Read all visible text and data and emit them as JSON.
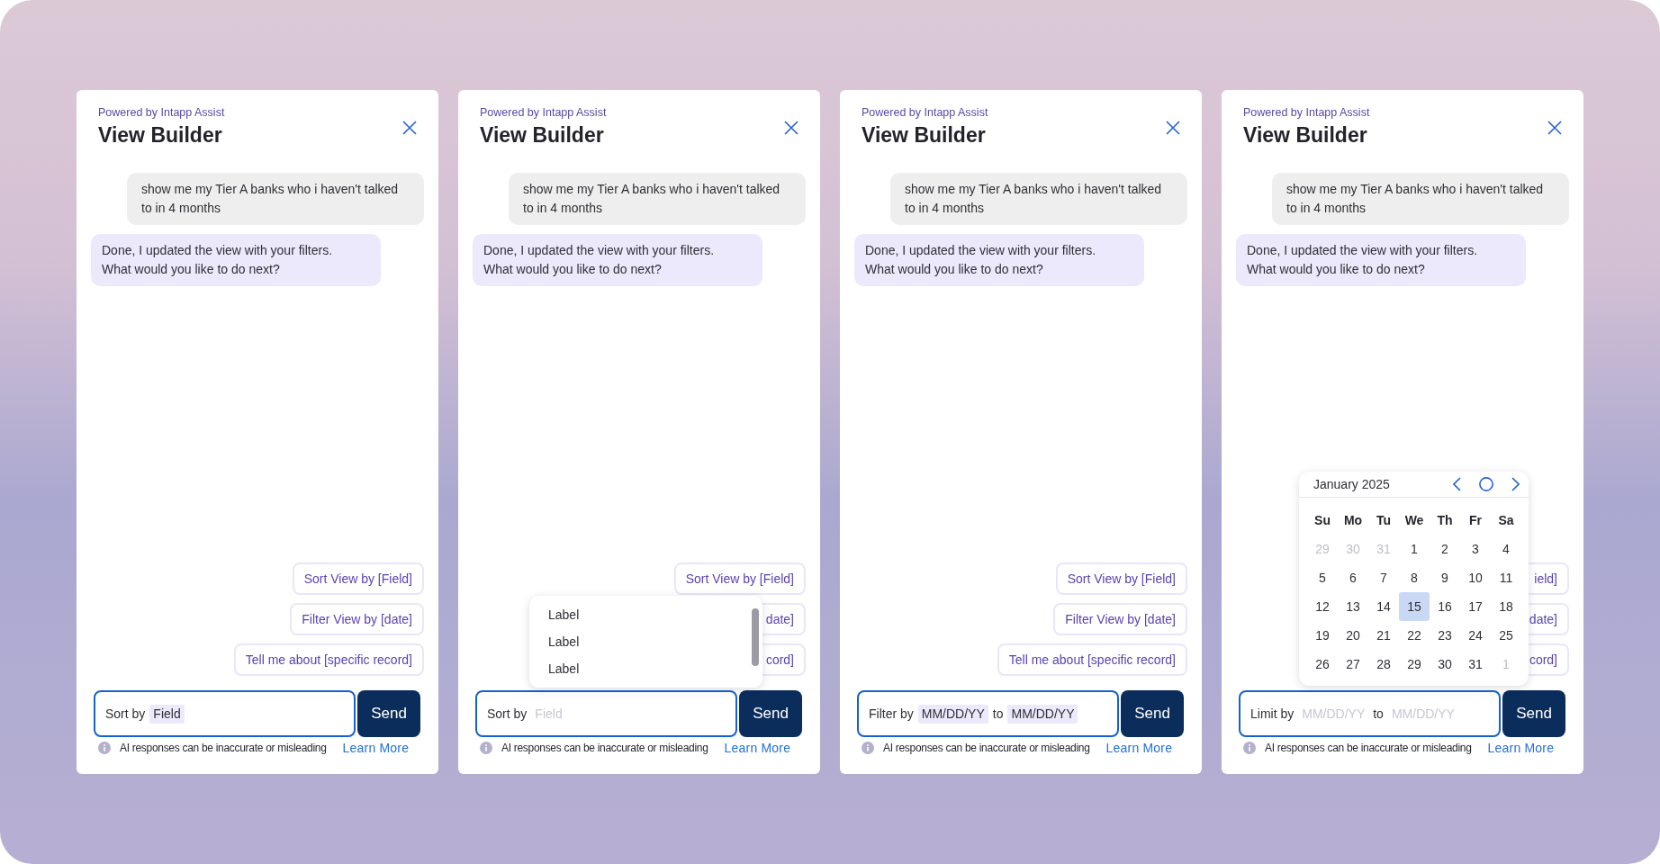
{
  "panels": [
    {
      "powered_by": "Powered by Intapp Assist",
      "title": "View Builder",
      "messages": [
        {
          "kind": "user",
          "text": "show me my Tier A banks who i haven't talked to in 4 months"
        },
        {
          "kind": "assistant",
          "text": "Done, I updated the view with your filters. What would you like to do next?"
        }
      ],
      "suggestions": [
        "Sort View by [Field]",
        "Filter View by [date]",
        "Tell me about [specific record]"
      ],
      "composer": {
        "focused": true,
        "parts": [
          {
            "kind": "text",
            "text": "Sort by"
          },
          {
            "kind": "slot",
            "value": "Field"
          }
        ]
      },
      "send_button": "Send",
      "disclaimer": "AI responses can be inaccurate or misleading",
      "learn_more": "Learn More"
    },
    {
      "powered_by": "Powered by Intapp Assist",
      "title": "View Builder",
      "messages": [
        {
          "kind": "user",
          "text": "show me my Tier A banks who i haven't talked to in 4 months"
        },
        {
          "kind": "assistant",
          "text": "Done, I updated the view with your filters. What would you like to do next?"
        }
      ],
      "suggestions": [
        "Sort View by [Field]",
        "date]",
        "cord]"
      ],
      "dropdown": {
        "options": [
          {
            "label": "Label",
            "selected": false
          },
          {
            "label": "Label",
            "selected": false
          },
          {
            "label": "Label",
            "selected": false
          }
        ]
      },
      "composer": {
        "focused": true,
        "parts": [
          {
            "kind": "text",
            "text": "Sort by"
          },
          {
            "kind": "slot",
            "placeholder": "Field"
          }
        ]
      },
      "send_button": "Send",
      "disclaimer": "AI responses can be inaccurate or misleading",
      "learn_more": "Learn More"
    },
    {
      "powered_by": "Powered by Intapp Assist",
      "title": "View Builder",
      "messages": [
        {
          "kind": "user",
          "text": "show me my Tier A banks who i haven't talked to in 4 months"
        },
        {
          "kind": "assistant",
          "text": "Done, I updated the view with your filters. What would you like to do next?"
        }
      ],
      "suggestions": [
        "Sort View by [Field]",
        "Filter View by [date]",
        "Tell me about [specific record]"
      ],
      "composer": {
        "focused": true,
        "parts": [
          {
            "kind": "text",
            "text": "Filter by"
          },
          {
            "kind": "slot",
            "value": "MM/DD/YY"
          },
          {
            "kind": "text",
            "text": "to"
          },
          {
            "kind": "slot",
            "value": "MM/DD/YY"
          }
        ]
      },
      "send_button": "Send",
      "disclaimer": "AI responses can be inaccurate or misleading",
      "learn_more": "Learn More"
    },
    {
      "powered_by": "Powered by Intapp Assist",
      "title": "View Builder",
      "messages": [
        {
          "kind": "user",
          "text": "show me my Tier A banks who i haven't talked to in 4 months"
        },
        {
          "kind": "assistant",
          "text": "Done, I updated the view with your filters. What would you like to do next?"
        }
      ],
      "suggestions": [
        "ield]",
        "date]",
        "cord]"
      ],
      "calendar": {
        "month": "January 2025",
        "weekdays": [
          "Su",
          "Mo",
          "Tu",
          "We",
          "Th",
          "Fr",
          "Sa"
        ],
        "days": [
          {
            "label": "29",
            "outside": true,
            "selected": false
          },
          {
            "label": "30",
            "outside": true,
            "selected": false
          },
          {
            "label": "31",
            "outside": true,
            "selected": false
          },
          {
            "label": "1",
            "outside": false,
            "selected": false
          },
          {
            "label": "2",
            "outside": false,
            "selected": false
          },
          {
            "label": "3",
            "outside": false,
            "selected": false
          },
          {
            "label": "4",
            "outside": false,
            "selected": false
          },
          {
            "label": "5",
            "outside": false,
            "selected": false
          },
          {
            "label": "6",
            "outside": false,
            "selected": false
          },
          {
            "label": "7",
            "outside": false,
            "selected": false
          },
          {
            "label": "8",
            "outside": false,
            "selected": false
          },
          {
            "label": "9",
            "outside": false,
            "selected": false
          },
          {
            "label": "10",
            "outside": false,
            "selected": false
          },
          {
            "label": "11",
            "outside": false,
            "selected": false
          },
          {
            "label": "12",
            "outside": false,
            "selected": false
          },
          {
            "label": "13",
            "outside": false,
            "selected": false
          },
          {
            "label": "14",
            "outside": false,
            "selected": false
          },
          {
            "label": "15",
            "outside": false,
            "selected": true
          },
          {
            "label": "16",
            "outside": false,
            "selected": false
          },
          {
            "label": "17",
            "outside": false,
            "selected": false
          },
          {
            "label": "18",
            "outside": false,
            "selected": false
          },
          {
            "label": "19",
            "outside": false,
            "selected": false
          },
          {
            "label": "20",
            "outside": false,
            "selected": false
          },
          {
            "label": "21",
            "outside": false,
            "selected": false
          },
          {
            "label": "22",
            "outside": false,
            "selected": false
          },
          {
            "label": "23",
            "outside": false,
            "selected": false
          },
          {
            "label": "24",
            "outside": false,
            "selected": false
          },
          {
            "label": "25",
            "outside": false,
            "selected": false
          },
          {
            "label": "26",
            "outside": false,
            "selected": false
          },
          {
            "label": "27",
            "outside": false,
            "selected": false
          },
          {
            "label": "28",
            "outside": false,
            "selected": false
          },
          {
            "label": "29",
            "outside": false,
            "selected": false
          },
          {
            "label": "30",
            "outside": false,
            "selected": false
          },
          {
            "label": "31",
            "outside": false,
            "selected": false
          },
          {
            "label": "1",
            "outside": true,
            "selected": false
          }
        ]
      },
      "composer": {
        "focused": true,
        "parts": [
          {
            "kind": "text",
            "text": "Limit by"
          },
          {
            "kind": "slot",
            "placeholder": "MM/DD/YY"
          },
          {
            "kind": "text",
            "text": "to"
          },
          {
            "kind": "slot",
            "placeholder": "MM/DD/YY"
          }
        ]
      },
      "send_button": "Send",
      "disclaimer": "AI responses can be inaccurate or misleading",
      "learn_more": "Learn More"
    }
  ]
}
